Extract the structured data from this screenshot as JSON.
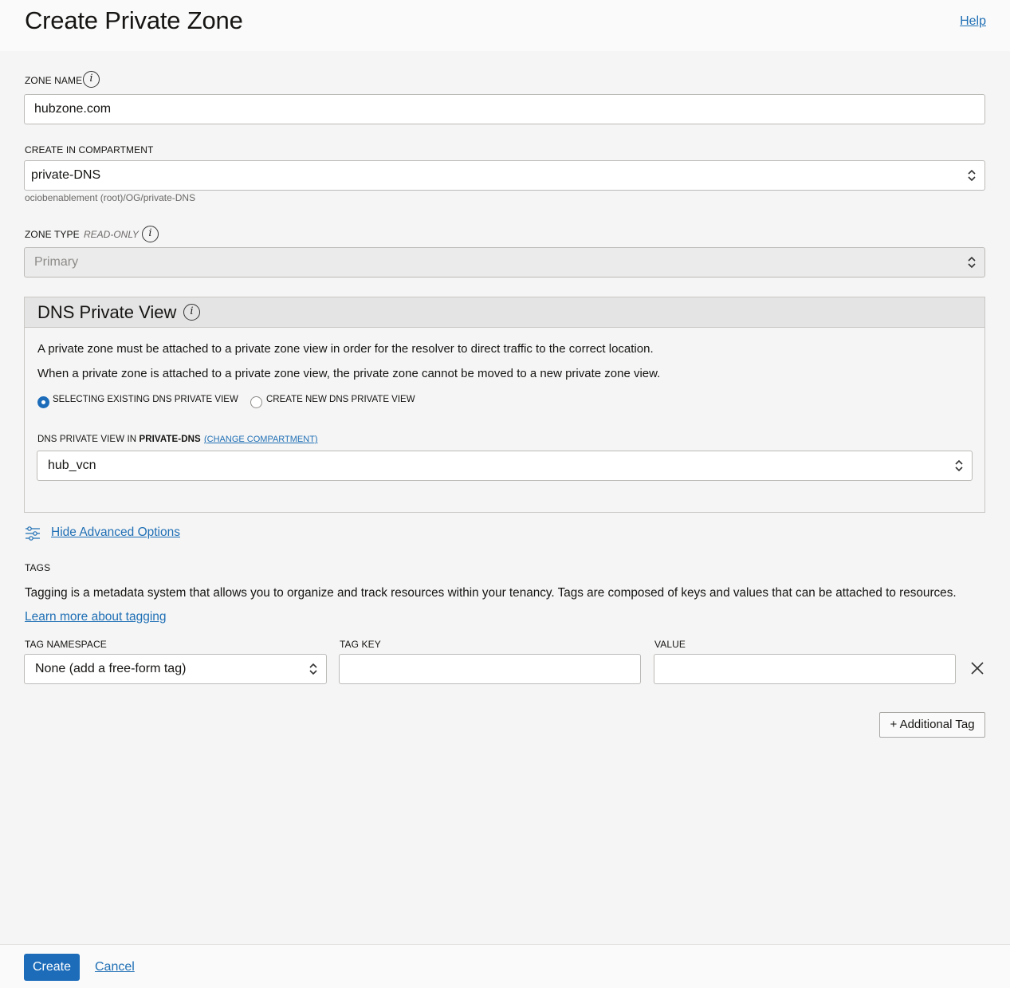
{
  "header": {
    "title": "Create Private Zone",
    "help": "Help"
  },
  "zone_name": {
    "label": "ZONE NAME",
    "value": "hubzone.com",
    "info_icon": "info-icon"
  },
  "compartment": {
    "label": "CREATE IN COMPARTMENT",
    "value": "private-DNS",
    "path_hint": "ociobenablement (root)/OG/private-DNS"
  },
  "zone_type": {
    "label": "ZONE TYPE",
    "readonly": "READ-ONLY",
    "value": "Primary"
  },
  "dns_view": {
    "title": "DNS Private View",
    "desc1": "A private zone must be attached to a private zone view in order for the resolver to direct traffic to the correct location.",
    "desc2": "When a private zone is attached to a private zone view, the private zone cannot be moved to a new private zone view.",
    "option_existing": "SELECTING EXISTING DNS PRIVATE VIEW",
    "option_new": "CREATE NEW DNS PRIVATE VIEW",
    "selected_option": "existing",
    "view_label_prefix": "DNS PRIVATE VIEW IN",
    "view_label_compartment": "PRIVATE-DNS",
    "change_compartment": "(CHANGE COMPARTMENT)",
    "view_value": "hub_vcn"
  },
  "advanced": {
    "toggle_label": "Hide Advanced Options"
  },
  "tags": {
    "section_label": "TAGS",
    "description": "Tagging is a metadata system that allows you to organize and track resources within your tenancy. Tags are composed of keys and values that can be attached to resources.",
    "learn_more": "Learn more about tagging",
    "namespace_label": "TAG NAMESPACE",
    "namespace_value": "None (add a free-form tag)",
    "key_label": "TAG KEY",
    "key_value": "",
    "value_label": "VALUE",
    "value_value": "",
    "add_button": "+ Additional Tag"
  },
  "footer": {
    "create": "Create",
    "cancel": "Cancel"
  },
  "colors": {
    "primary": "#1c6cba",
    "link": "#1f6fb5"
  }
}
